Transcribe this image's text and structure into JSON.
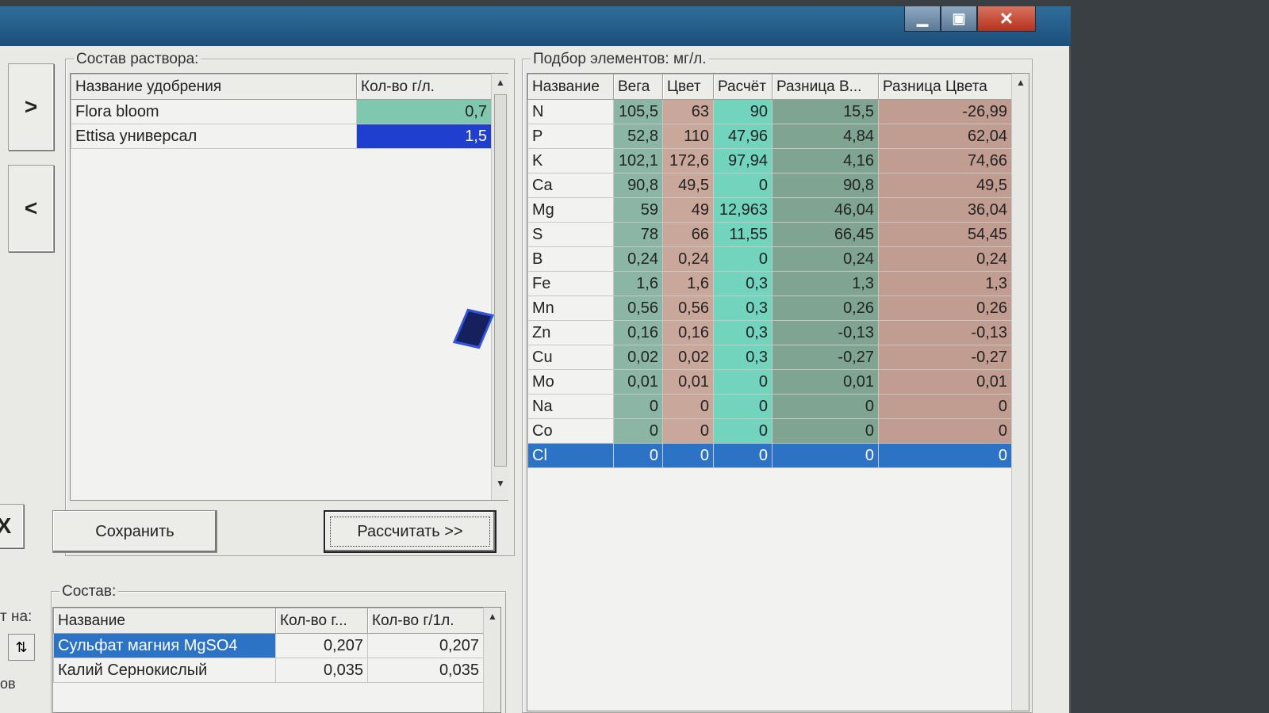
{
  "window": {
    "controls": {
      "minimize": "▁",
      "maximize": "▣",
      "close": "✕"
    }
  },
  "nav": {
    "add_arrow": ">",
    "remove_arrow": "<",
    "delete_icon": "X"
  },
  "solution": {
    "legend": "Состав раствора:",
    "headers": [
      "Название удобрения",
      "Кол-во г/л."
    ],
    "rows": [
      {
        "name": "Flora bloom",
        "qty": "0,7"
      },
      {
        "name": "Ettisa универсал",
        "qty": "1,5"
      }
    ],
    "save_label": "Сохранить",
    "calc_label": "Рассчитать >>"
  },
  "elements": {
    "legend": "Подбор элементов: мг/л.",
    "headers": [
      "Название",
      "Вега",
      "Цвет",
      "Расчёт",
      "Разница В...",
      "Разница Цвета"
    ],
    "rows": [
      [
        "N",
        "105,5",
        "63",
        "90",
        "15,5",
        "-26,99"
      ],
      [
        "P",
        "52,8",
        "110",
        "47,96",
        "4,84",
        "62,04"
      ],
      [
        "K",
        "102,1",
        "172,6",
        "97,94",
        "4,16",
        "74,66"
      ],
      [
        "Ca",
        "90,8",
        "49,5",
        "0",
        "90,8",
        "49,5"
      ],
      [
        "Mg",
        "59",
        "49",
        "12,963",
        "46,04",
        "36,04"
      ],
      [
        "S",
        "78",
        "66",
        "11,55",
        "66,45",
        "54,45"
      ],
      [
        "B",
        "0,24",
        "0,24",
        "0",
        "0,24",
        "0,24"
      ],
      [
        "Fe",
        "1,6",
        "1,6",
        "0,3",
        "1,3",
        "1,3"
      ],
      [
        "Mn",
        "0,56",
        "0,56",
        "0,3",
        "0,26",
        "0,26"
      ],
      [
        "Zn",
        "0,16",
        "0,16",
        "0,3",
        "-0,13",
        "-0,13"
      ],
      [
        "Cu",
        "0,02",
        "0,02",
        "0,3",
        "-0,27",
        "-0,27"
      ],
      [
        "Mo",
        "0,01",
        "0,01",
        "0",
        "0,01",
        "0,01"
      ],
      [
        "Na",
        "0",
        "0",
        "0",
        "0",
        "0"
      ],
      [
        "Co",
        "0",
        "0",
        "0",
        "0",
        "0"
      ],
      [
        "Cl",
        "0",
        "0",
        "0",
        "0",
        "0"
      ]
    ],
    "selected_row": 14
  },
  "composition": {
    "legend": "Состав:",
    "side_label": "т на:",
    "side_label2": "ов",
    "headers": [
      "Название",
      "Кол-во г...",
      "Кол-во г/1л."
    ],
    "rows": [
      {
        "name": "Сульфат магния MgSO4",
        "qty": "0,207",
        "qty1": "0,207"
      },
      {
        "name": "Калий Сернокислый",
        "qty": "0,035",
        "qty1": "0,035"
      }
    ]
  },
  "colors": {
    "qty_green": "#7fc7ae",
    "qty_blue": "#1f3fcf",
    "vega": "#8bb6a5",
    "color": "#c9a79b",
    "calc": "#72d4bd",
    "diff_v": "#7fa592",
    "diff_c": "#c19c90",
    "selection": "#2c73c6"
  }
}
